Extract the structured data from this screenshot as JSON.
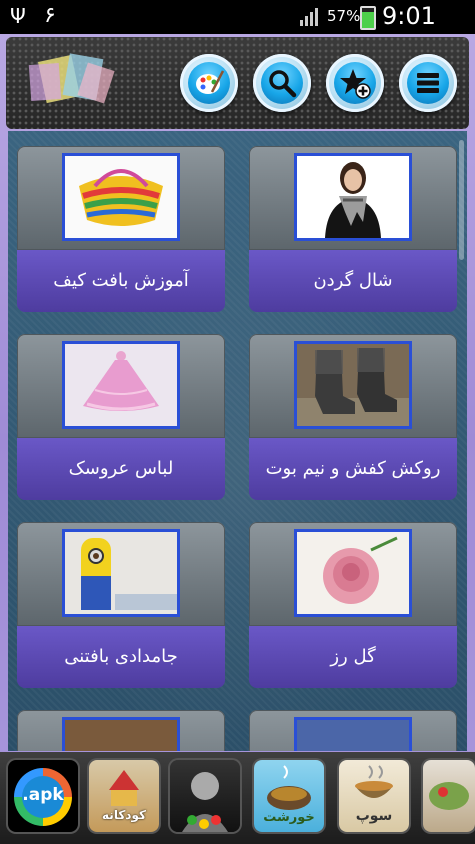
{
  "statusbar": {
    "usb_icon": "usb-icon",
    "notification": "۶",
    "battery_pct": "57%",
    "time": "9:01 AM"
  },
  "header": {
    "buttons": [
      {
        "name": "palette-button",
        "icon": "palette-icon"
      },
      {
        "name": "search-button",
        "icon": "search-icon"
      },
      {
        "name": "favorite-add-button",
        "icon": "star-plus-icon"
      },
      {
        "name": "menu-button",
        "icon": "menu-icon"
      }
    ]
  },
  "cards": [
    {
      "label": "شال گردن",
      "thumb": "scarf-photo"
    },
    {
      "label": "آموزش بافت کیف",
      "thumb": "knitted-bag-photo"
    },
    {
      "label": "روکش کفش و نیم بوت",
      "thumb": "boot-cover-photo"
    },
    {
      "label": "لباس عروسک",
      "thumb": "doll-dress-photo"
    },
    {
      "label": "گل رز",
      "thumb": "crochet-rose-photo"
    },
    {
      "label": "جامدادی بافتنی",
      "thumb": "knitted-pencil-case-photo"
    }
  ],
  "bottom_apps": [
    {
      "label": ".apk",
      "icon": "apk-icon"
    },
    {
      "label": "کودکانه",
      "icon": "kids-songs-icon"
    },
    {
      "label": "",
      "icon": "dark-portrait-icon"
    },
    {
      "label": "خورشت",
      "icon": "stew-icon"
    },
    {
      "label": "سوپ",
      "icon": "soup-icon"
    },
    {
      "label": "",
      "icon": "food-icon"
    }
  ]
}
